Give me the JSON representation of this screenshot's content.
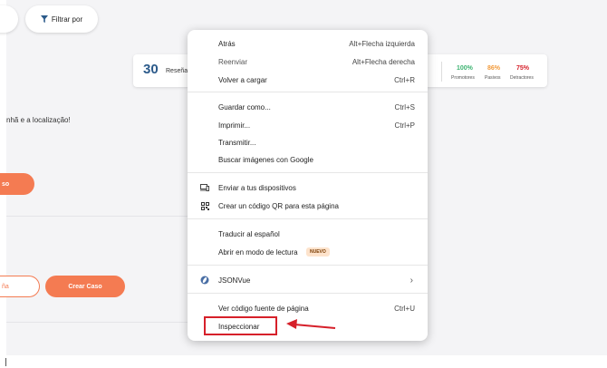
{
  "background": {
    "filter_button": "Filtrar por",
    "stats": {
      "count": "30",
      "count_label": "Reseña",
      "promoters_pct": "100%",
      "passives_pct": "86%",
      "detractors_pct": "75%",
      "promoters_label": "Promotores",
      "passives_label": "Pasivos",
      "detractors_label": "Detractores"
    },
    "text_fragment": "nhã e a localização!",
    "orange_button_fragment": "so",
    "outline_button_fragment": "ña",
    "crear_caso": "Crear Caso"
  },
  "colors": {
    "accent_orange": "#f47b52",
    "promoters": "#3cb371",
    "passives": "#f29a3a",
    "detractors": "#d6202a",
    "highlight_red": "#d6202a"
  },
  "context_menu": {
    "items": [
      {
        "label": "Atrás",
        "shortcut": "Alt+Flecha izquierda"
      },
      {
        "label": "Reenviar",
        "shortcut": "Alt+Flecha derecha"
      },
      {
        "label": "Volver a cargar",
        "shortcut": "Ctrl+R"
      },
      {
        "label": "Guardar como...",
        "shortcut": "Ctrl+S"
      },
      {
        "label": "Imprimir...",
        "shortcut": "Ctrl+P"
      },
      {
        "label": "Transmitir..."
      },
      {
        "label": "Buscar imágenes con Google"
      },
      {
        "label": "Enviar a tus dispositivos",
        "icon": "devices-icon"
      },
      {
        "label": "Crear un código QR para esta página",
        "icon": "qr-code-icon"
      },
      {
        "label": "Traducir al español"
      },
      {
        "label": "Abrir en modo de lectura",
        "badge": "NUEVO"
      },
      {
        "label": "JSONVue",
        "icon": "jsonvue-icon"
      },
      {
        "label": "Ver código fuente de página",
        "shortcut": "Ctrl+U"
      },
      {
        "label": "Inspeccionar"
      }
    ]
  }
}
